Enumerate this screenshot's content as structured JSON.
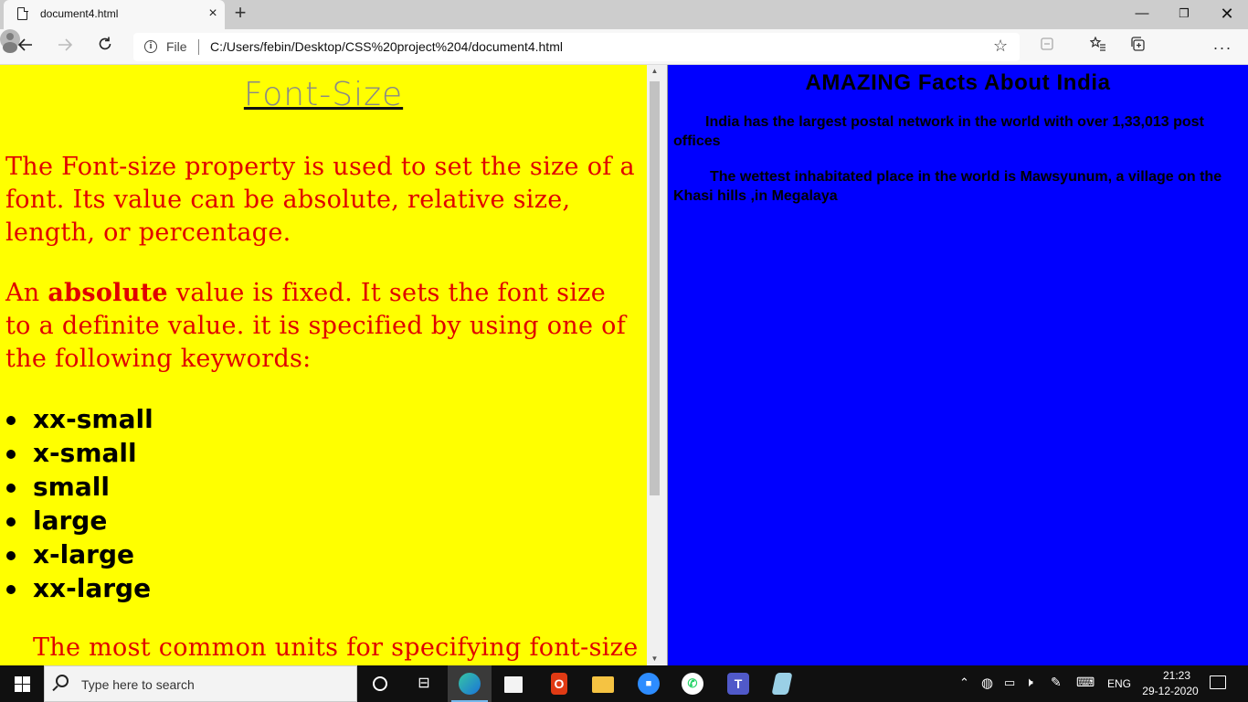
{
  "browser": {
    "tab_title": "document4.html",
    "tab_close": "×",
    "new_tab": "+",
    "address_label": "File",
    "url": "C:/Users/febin/Desktop/CSS%20project%204/document4.html",
    "window_controls": {
      "minimize": "—",
      "restore": "❐",
      "close": "✕"
    },
    "icons": [
      "document-icon",
      "back-arrow-icon",
      "forward-arrow-icon",
      "refresh-icon",
      "info-icon",
      "favorite-star-icon",
      "reading-view-icon",
      "favorites-icon",
      "collections-icon",
      "profile-icon",
      "more-menu-icon"
    ]
  },
  "left_page": {
    "title": "Font-Size",
    "para1": "The Font-size property is used to set the size of a font. Its value can be absolute, relative size, length, or percentage.",
    "para2_before": "An ",
    "para2_bold": "absolute",
    "para2_after": " value is fixed. It sets the font size to a definite value. it is specified by using one of the following keywords:",
    "keywords": [
      "xx-small",
      "x-small",
      "small",
      "large",
      "x-large",
      "xx-large"
    ],
    "para3": "The most common units for specifying font-size",
    "colors": {
      "background": "#ffff00",
      "text": "#e00000",
      "title": "#888888"
    }
  },
  "right_page": {
    "title": "AMAZING Facts About India",
    "facts": [
      "India has the largest postal network in the world with over 1,33,013 post offices",
      "The wettest inhabitated place in the world is Mawsyunum, a village on the Khasi hills ,in Megalaya"
    ],
    "colors": {
      "background": "#0000ff",
      "text": "#000000"
    }
  },
  "taskbar": {
    "search_placeholder": "Type here to search",
    "apps": [
      "task-view-icon",
      "edge-icon",
      "store-icon",
      "office-icon",
      "file-explorer-icon",
      "zoom-icon",
      "whatsapp-icon",
      "teams-icon",
      "notepad-app-icon"
    ],
    "tray": {
      "language": "ENG",
      "time": "21:23",
      "date": "29-12-2020"
    }
  }
}
